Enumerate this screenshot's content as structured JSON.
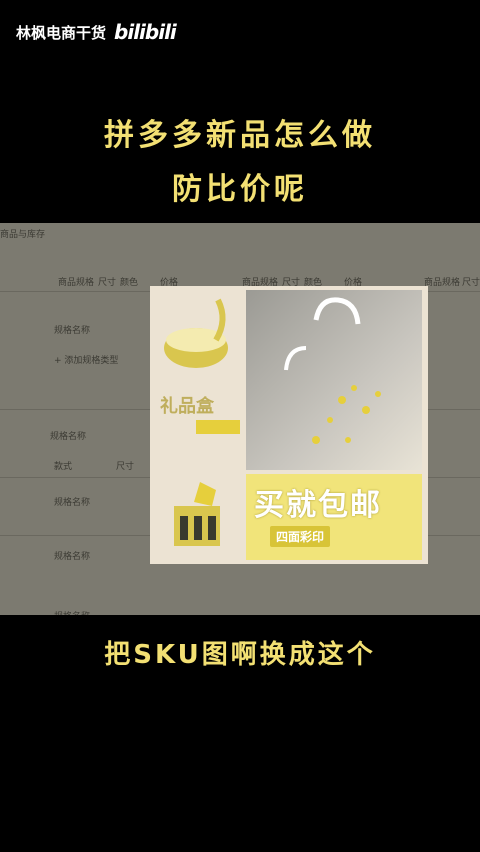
{
  "header": {
    "channel": "林枫电商干货",
    "logo": "bilibili"
  },
  "title": {
    "line1": "拼多多新品怎么做",
    "line2": "防比价呢"
  },
  "screenshot": {
    "col_headers": [
      "商品规格",
      "尺寸",
      "颜色",
      "价格"
    ],
    "row_labels": [
      "规格名称",
      "款式",
      "尺寸",
      "颜色"
    ],
    "add_spec": "+ 添加规格类型",
    "collage": {
      "gift_label": "礼品盒",
      "promo_main": "买就包邮",
      "promo_sub": "四面彩印"
    }
  },
  "caption": "把SKU图啊换成这个"
}
